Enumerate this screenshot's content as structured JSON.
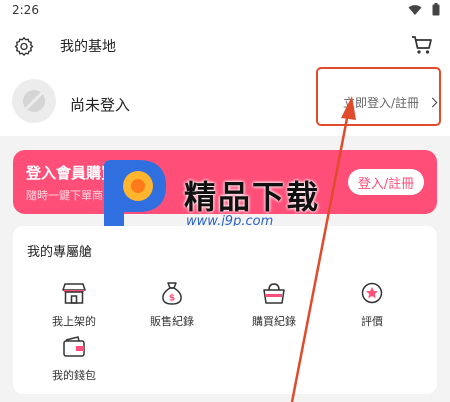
{
  "status_bar": {
    "time": "2:26"
  },
  "header": {
    "title": "我的基地"
  },
  "login": {
    "status": "尚未登入",
    "link": "立即登入/註冊"
  },
  "promo": {
    "title": "登入會員購買",
    "subtitle": "隨時一鍵下單商",
    "button": "登入/註冊",
    "color": "#ff4f78"
  },
  "watermark": {
    "title": "精品下载",
    "url": "www.j9p.com"
  },
  "services": {
    "title": "我的專屬艙",
    "items": [
      {
        "label": "我上架的",
        "icon": "storefront-icon"
      },
      {
        "label": "販售紀錄",
        "icon": "money-bag-icon"
      },
      {
        "label": "購買紀錄",
        "icon": "shopping-basket-icon"
      },
      {
        "label": "評價",
        "icon": "star-badge-icon"
      },
      {
        "label": "我的錢包",
        "icon": "wallet-icon"
      }
    ]
  },
  "annotation": {
    "color": "#e04b2c"
  }
}
